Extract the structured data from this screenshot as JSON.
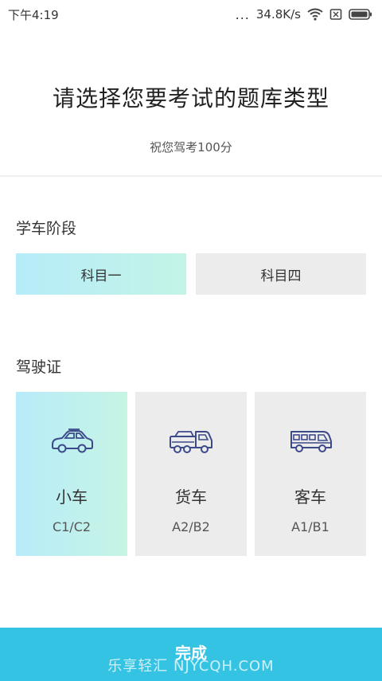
{
  "status_bar": {
    "time": "下午4:19",
    "dots": "...",
    "speed": "34.8K/s"
  },
  "header": {
    "title": "请选择您要考试的题库类型",
    "subtitle": "祝您驾考100分"
  },
  "stage_section": {
    "label": "学车阶段",
    "options": [
      {
        "label": "科目一",
        "selected": true
      },
      {
        "label": "科目四",
        "selected": false
      }
    ]
  },
  "license_section": {
    "label": "驾驶证",
    "options": [
      {
        "name": "小车",
        "code": "C1/C2",
        "icon": "car-icon",
        "selected": true
      },
      {
        "name": "货车",
        "code": "A2/B2",
        "icon": "truck-icon",
        "selected": false
      },
      {
        "name": "客车",
        "code": "A1/B1",
        "icon": "bus-icon",
        "selected": false
      }
    ]
  },
  "done_button": {
    "label": "完成"
  },
  "watermark": "乐享轻汇 NJYCQH.COM",
  "colors": {
    "accent": "#35c3e4",
    "icon_stroke": "#3d4a8a",
    "selected_gradient_start": "#b6ecf9",
    "selected_gradient_end": "#c4f4e6",
    "unselected_bg": "#ececec"
  }
}
